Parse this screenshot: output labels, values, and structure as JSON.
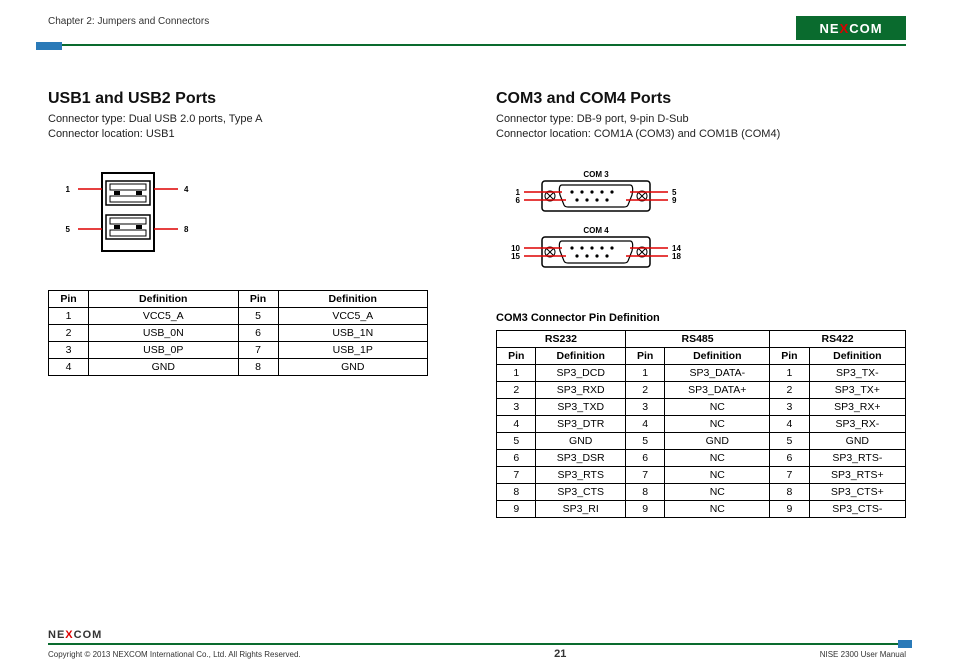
{
  "header": {
    "chapter": "Chapter 2: Jumpers and Connectors",
    "brand_pre": "NE",
    "brand_x": "X",
    "brand_post": "COM"
  },
  "left": {
    "title": "USB1 and USB2 Ports",
    "type_line": "Connector type: Dual USB 2.0 ports, Type A",
    "loc_line": "Connector location: USB1",
    "diagram_pins": {
      "tl": "1",
      "tr": "4",
      "bl": "5",
      "br": "8"
    },
    "table_headers": {
      "pin": "Pin",
      "def": "Definition"
    },
    "rows": [
      {
        "p1": "1",
        "d1": "VCC5_A",
        "p2": "5",
        "d2": "VCC5_A"
      },
      {
        "p1": "2",
        "d1": "USB_0N",
        "p2": "6",
        "d2": "USB_1N"
      },
      {
        "p1": "3",
        "d1": "USB_0P",
        "p2": "7",
        "d2": "USB_1P"
      },
      {
        "p1": "4",
        "d1": "GND",
        "p2": "8",
        "d2": "GND"
      }
    ]
  },
  "right": {
    "title": "COM3 and COM4 Ports",
    "type_line": "Connector type: DB-9 port, 9-pin D-Sub",
    "loc_line": "Connector location: COM1A (COM3) and COM1B (COM4)",
    "com3_label": "COM 3",
    "com4_label": "COM 4",
    "com3_pins": {
      "tl": "1",
      "tr": "5",
      "bl": "6",
      "br": "9"
    },
    "com4_pins": {
      "tl": "10",
      "tr": "14",
      "bl": "15",
      "br": "18"
    },
    "subheading": "COM3 Connector Pin Definition",
    "group_headers": {
      "g1": "RS232",
      "g2": "RS485",
      "g3": "RS422"
    },
    "col_headers": {
      "pin": "Pin",
      "def": "Definition"
    },
    "rows": [
      {
        "a_p": "1",
        "a_d": "SP3_DCD",
        "b_p": "1",
        "b_d": "SP3_DATA-",
        "c_p": "1",
        "c_d": "SP3_TX-"
      },
      {
        "a_p": "2",
        "a_d": "SP3_RXD",
        "b_p": "2",
        "b_d": "SP3_DATA+",
        "c_p": "2",
        "c_d": "SP3_TX+"
      },
      {
        "a_p": "3",
        "a_d": "SP3_TXD",
        "b_p": "3",
        "b_d": "NC",
        "c_p": "3",
        "c_d": "SP3_RX+"
      },
      {
        "a_p": "4",
        "a_d": "SP3_DTR",
        "b_p": "4",
        "b_d": "NC",
        "c_p": "4",
        "c_d": "SP3_RX-"
      },
      {
        "a_p": "5",
        "a_d": "GND",
        "b_p": "5",
        "b_d": "GND",
        "c_p": "5",
        "c_d": "GND"
      },
      {
        "a_p": "6",
        "a_d": "SP3_DSR",
        "b_p": "6",
        "b_d": "NC",
        "c_p": "6",
        "c_d": "SP3_RTS-"
      },
      {
        "a_p": "7",
        "a_d": "SP3_RTS",
        "b_p": "7",
        "b_d": "NC",
        "c_p": "7",
        "c_d": "SP3_RTS+"
      },
      {
        "a_p": "8",
        "a_d": "SP3_CTS",
        "b_p": "8",
        "b_d": "NC",
        "c_p": "8",
        "c_d": "SP3_CTS+"
      },
      {
        "a_p": "9",
        "a_d": "SP3_RI",
        "b_p": "9",
        "b_d": "NC",
        "c_p": "9",
        "c_d": "SP3_CTS-"
      }
    ]
  },
  "footer": {
    "copyright": "Copyright © 2013 NEXCOM International Co., Ltd. All Rights Reserved.",
    "page": "21",
    "manual": "NISE 2300 User Manual",
    "brand_pre": "NE",
    "brand_x": "X",
    "brand_post": "COM"
  }
}
